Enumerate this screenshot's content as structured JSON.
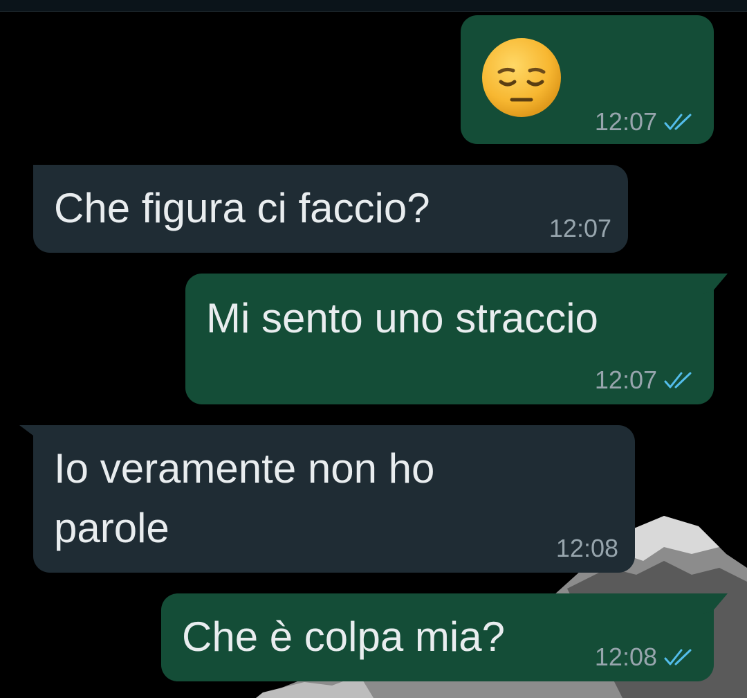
{
  "messages": [
    {
      "direction": "outgoing",
      "type": "emoji",
      "emoji_name": "pensive-face-emoji",
      "time": "12:07",
      "status": "read"
    },
    {
      "direction": "incoming",
      "type": "text",
      "text": "Che figura ci faccio?",
      "time": "12:07"
    },
    {
      "direction": "outgoing",
      "type": "text",
      "text": "Mi sento uno straccio",
      "time": "12:07",
      "status": "read"
    },
    {
      "direction": "incoming",
      "type": "text",
      "text_lines": [
        "Io veramente non ho",
        "parole"
      ],
      "time": "12:08"
    },
    {
      "direction": "outgoing",
      "type": "text",
      "text": "Che è colpa mia?",
      "time": "12:08",
      "status": "read"
    }
  ],
  "colors": {
    "background": "#000000",
    "incoming_bubble": "#1f2c34",
    "outgoing_bubble": "#144d37",
    "message_text": "#e9edef",
    "timestamp": "#97a5ad",
    "read_ticks": "#53bdeb"
  }
}
